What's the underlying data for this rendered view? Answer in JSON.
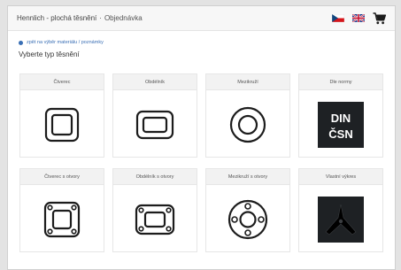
{
  "header": {
    "title": "Hennlich - plochá těsnění",
    "separator": "·",
    "order_link": "Objednávka",
    "languages": [
      {
        "code": "cs",
        "icon": "czech-flag-icon"
      },
      {
        "code": "en",
        "icon": "uk-flag-icon"
      }
    ],
    "cart_icon": "cart-icon"
  },
  "back_link": "zpět na výběr materiálu / poznámky",
  "section_title": "Vyberte typ těsnění",
  "shapes": [
    {
      "label": "Čtverec",
      "icon": "square-gasket-icon"
    },
    {
      "label": "Obdélník",
      "icon": "rectangle-gasket-icon"
    },
    {
      "label": "Mezikruží",
      "icon": "ring-gasket-icon"
    },
    {
      "label": "Dle normy",
      "icon": "din-csn-icon",
      "icon_text": [
        "DIN",
        "ČSN"
      ]
    },
    {
      "label": "Čtverec s otvory",
      "icon": "square-holes-gasket-icon"
    },
    {
      "label": "Obdélník s otvory",
      "icon": "rectangle-holes-gasket-icon"
    },
    {
      "label": "Mezikruží s otvory",
      "icon": "ring-holes-gasket-icon"
    },
    {
      "label": "Vlastní výkres",
      "icon": "custom-drawing-icon"
    }
  ],
  "colors": {
    "accent": "#3a6fb5",
    "icon_dark": "#1c1c1c",
    "header_bg": "#f2f2f2"
  }
}
